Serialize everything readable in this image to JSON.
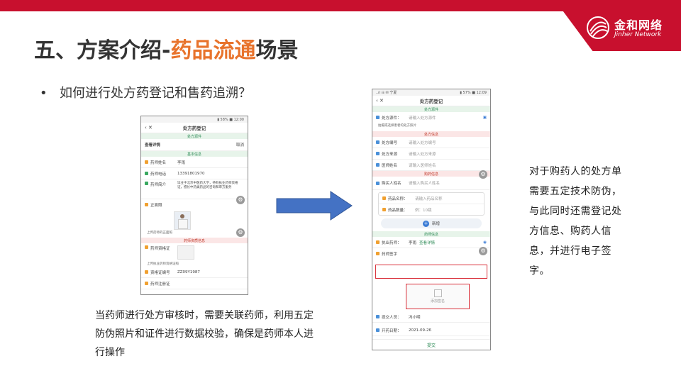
{
  "slide": {
    "title_prefix": "五、方案介绍-",
    "title_highlight": "药品流通",
    "title_suffix": "场景",
    "bullet_text": "如何进行处方药登记和售药追溯？",
    "caption": "当药师进行处方审核时，需要关联药师，利用五定防伪照片和证件进行数据校验，确保是药师本人进行操作",
    "right_text": "对于购药人的处方单需要五定技术防伪，与此同时还需登记处方信息、购药人信息，并进行电子签字。"
  },
  "logo": {
    "cn": "金和网络",
    "en": "Jinher Network",
    "brand_color": "#c8102e"
  },
  "phone_left": {
    "status_right": "▮ 58% ■ 12:00",
    "nav_icons": "‹  ✕",
    "nav_title": "处方药登记",
    "top_band": "处方源件",
    "sheet_title": "查看详情",
    "sheet_action": "取消",
    "band_basic": "基本信息",
    "fields": [
      {
        "label": "药师姓名",
        "value": "李雨"
      },
      {
        "label": "药师电话",
        "value": "13391801970"
      },
      {
        "label": "药师简介",
        "value": "毕业于北京中医药大学，持有执业药师资格证，擅长中药类药品的咨询和审方服务"
      },
      {
        "label": "正面照",
        "value": ""
      }
    ],
    "photo_hint": "上传药师的正面照",
    "band_license": "药师资质信息",
    "license_label": "药师资格证",
    "license_hint": "上传执业药师资格证照",
    "cert_number_label": "资格证编号",
    "cert_number_value": "ZZ09Y1987",
    "reg_cert_label": "药师注册证"
  },
  "phone_right": {
    "status_left": "..ıl ☷ ✉ 宁夏",
    "status_right": "▮ 57% ■ 12:09",
    "nav_icons": "‹  ✕",
    "nav_title": "处方药登记",
    "band_source": "处方源件",
    "source_label": "处方源件：",
    "source_placeholder": "请输入处方源件",
    "source_hint": "拍摄或选择患者的处方照片",
    "band_info": "处方信息",
    "info_rows": [
      {
        "label": "处方编号",
        "placeholder": "请输入处方编号"
      },
      {
        "label": "处方来源",
        "placeholder": "请输入处方来源"
      },
      {
        "label": "医师姓名",
        "placeholder": "请输入医师姓名"
      }
    ],
    "band_buyer": "购药信息",
    "buyer_label": "购买人姓名",
    "buyer_placeholder": "请输入购买人姓名",
    "drug_name_label": "药品名称：",
    "drug_name_placeholder": "请输入药品名称",
    "drug_qty_label": "药品数量：",
    "drug_qty_placeholder": "例：10瓶",
    "add_label": "新增",
    "band_pharmacist": "药师信息",
    "pharmacist_label": "执业药师：",
    "pharmacist_name": "李雨",
    "pharmacist_link": "查看详情",
    "signature_label": "药师签字",
    "signature_hint": "添加签名",
    "submitter_label": "提交人员：",
    "submitter_value": "冯小明",
    "date_label": "开药日期：",
    "date_value": "2021-09-26",
    "submit_label": "提交"
  },
  "colors": {
    "title_highlight": "#e8732c",
    "arrow": "#4472c4",
    "annotation_box": "#d9303a"
  }
}
